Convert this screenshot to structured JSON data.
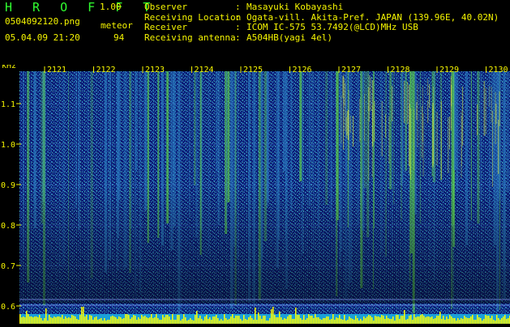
{
  "header": {
    "app_title": "H R O F F T",
    "app_version": "1.00",
    "filename": "0504092120.png",
    "datetime": "05.04.09 21:20",
    "meteor_label": "meteor",
    "meteor_count": "94",
    "info": [
      {
        "key": "Observer",
        "value": "Masayuki Kobayashi"
      },
      {
        "key": "Receiving Location",
        "value": "Ogata-vill. Akita-Pref. JAPAN (139.96E, 40.02N)"
      },
      {
        "key": "Receiver",
        "value": "ICOM IC-575 53.7492(@LCD)MHz USB"
      },
      {
        "key": "Receiving antenna",
        "value": "A504HB(yagi 4el)"
      }
    ]
  },
  "spectrogram": {
    "y_unit": "kHz",
    "freq_ticks": [
      "1.1",
      "1.0",
      "0.9",
      "0.8",
      "0.7",
      "0.6"
    ],
    "time_ticks": [
      "2121",
      "2122",
      "2123",
      "2124",
      "2125",
      "2126",
      "2127",
      "2128",
      "2129",
      "2130"
    ],
    "colors": {
      "background": "#0a1460",
      "noise": "#2a7ac0",
      "signal": "#5fd64a",
      "bright": "#e0f040",
      "bar": "#ffff00",
      "label": "#f5f500"
    }
  }
}
